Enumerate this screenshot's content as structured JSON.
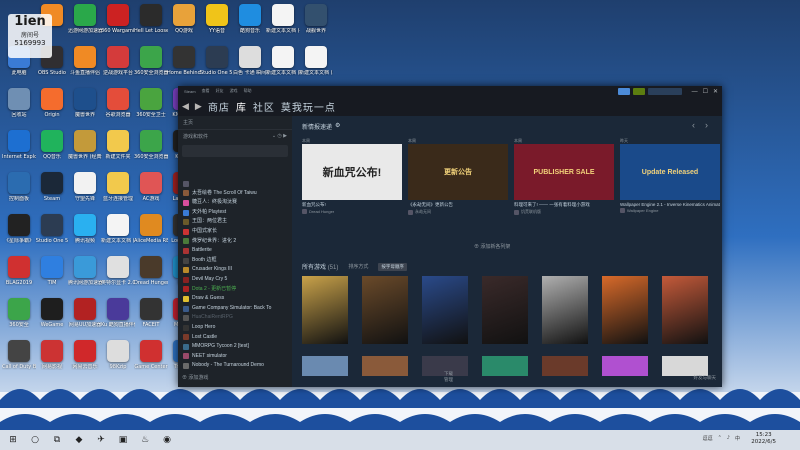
{
  "streamer": {
    "name": "1ien",
    "badge": "房间号",
    "room": "5169993"
  },
  "desktop": {
    "icons": [
      {
        "label": "Internet Explorer",
        "col": 0,
        "row": 3,
        "color": "#1d6fd1"
      },
      {
        "label": "",
        "col": 1,
        "row": 0,
        "color": "#f08a24"
      },
      {
        "label": "斗鱼直播伴侣",
        "col": 1,
        "row": 0,
        "color": "#f08a24"
      },
      {
        "label": "迅游网游加速器",
        "col": 2,
        "row": 0,
        "color": "#2aa84a"
      },
      {
        "label": "360 Wargami...",
        "col": 3,
        "row": 0,
        "color": "#cc2222"
      },
      {
        "label": "Hell Let Loose",
        "col": 4,
        "row": 0,
        "color": "#2b2b2b"
      },
      {
        "label": "QQ游戏",
        "col": 5,
        "row": 0,
        "color": "#e8a23a"
      },
      {
        "label": "YY语音",
        "col": 6,
        "row": 0,
        "color": "#f0c419"
      },
      {
        "label": "酷狗音乐",
        "col": 7,
        "row": 0,
        "color": "#1f8de0"
      },
      {
        "label": "新建文本文档 (4).txt",
        "col": 8,
        "row": 0,
        "color": "#f4f4f4"
      },
      {
        "label": "战舰世界",
        "col": 9,
        "row": 0,
        "color": "#33506e"
      },
      {
        "label": "此电脑",
        "col": 0,
        "row": 1,
        "color": "#3a7bd5"
      },
      {
        "label": "OBS Studio",
        "col": 1,
        "row": 1,
        "color": "#302e31"
      },
      {
        "label": "斗鱼直播伴侣",
        "col": 2,
        "row": 1,
        "color": "#f08a24"
      },
      {
        "label": "逆战游戏平台",
        "col": 3,
        "row": 1,
        "color": "#d43b3b"
      },
      {
        "label": "360安全浏览器",
        "col": 4,
        "row": 1,
        "color": "#3ca54a"
      },
      {
        "label": "Home Behind 2",
        "col": 5,
        "row": 1,
        "color": "#333"
      },
      {
        "label": "Studio One 5 Professi...",
        "col": 6,
        "row": 1,
        "color": "#2c3c52"
      },
      {
        "label": "白色 卡通 瞬间...",
        "col": 7,
        "row": 1,
        "color": "#ddd"
      },
      {
        "label": "新建文本文档 (2).txt",
        "col": 8,
        "row": 1,
        "color": "#f4f4f4"
      },
      {
        "label": "新建文本文档 (5).txt",
        "col": 9,
        "row": 1,
        "color": "#f4f4f4"
      },
      {
        "label": "回收站",
        "col": 0,
        "row": 2,
        "color": "#6f8fb3"
      },
      {
        "label": "Origin",
        "col": 1,
        "row": 2,
        "color": "#f56c2d"
      },
      {
        "label": "魔兽世界",
        "col": 2,
        "row": 2,
        "color": "#1e4f8c"
      },
      {
        "label": "谷歌浏览器",
        "col": 3,
        "row": 2,
        "color": "#e44d3a"
      },
      {
        "label": "360安全卫士",
        "col": 4,
        "row": 2,
        "color": "#4aa43f"
      },
      {
        "label": "KMPlayer",
        "col": 5,
        "row": 2,
        "color": "#7a3fbf"
      },
      {
        "label": "QQ音乐",
        "col": 1,
        "row": 3,
        "color": "#20b35c"
      },
      {
        "label": "魔兽世界 (经典怀旧服)",
        "col": 2,
        "row": 3,
        "color": "#c39a3a"
      },
      {
        "label": "新建文件夹",
        "col": 3,
        "row": 3,
        "color": "#f2c94c"
      },
      {
        "label": "360安全浏览器",
        "col": 4,
        "row": 3,
        "color": "#3ca54a"
      },
      {
        "label": "KKmini",
        "col": 5,
        "row": 3,
        "color": "#222"
      },
      {
        "label": "控制面板",
        "col": 0,
        "row": 4,
        "color": "#2b6cb0"
      },
      {
        "label": "Steam",
        "col": 1,
        "row": 4,
        "color": "#1b2838"
      },
      {
        "label": "守望先锋",
        "col": 2,
        "row": 4,
        "color": "#f2f2f2"
      },
      {
        "label": "蓝牙连接管理",
        "col": 3,
        "row": 4,
        "color": "#f2c94c"
      },
      {
        "label": "AC游戏",
        "col": 4,
        "row": 4,
        "color": "#e05555"
      },
      {
        "label": "Launch...",
        "col": 5,
        "row": 4,
        "color": "#a02020"
      },
      {
        "label": "《星际争霸》",
        "col": 0,
        "row": 5,
        "color": "#222"
      },
      {
        "label": "Studio One 5",
        "col": 1,
        "row": 5,
        "color": "#2c3c52"
      },
      {
        "label": "腾讯视频",
        "col": 2,
        "row": 5,
        "color": "#2ab0f0"
      },
      {
        "label": "新建文本文档 (2)",
        "col": 3,
        "row": 5,
        "color": "#f4f4f4"
      },
      {
        "label": "AliceMedia RECentral 4",
        "col": 4,
        "row": 5,
        "color": "#e08a20"
      },
      {
        "label": "Loop Hero",
        "col": 5,
        "row": 5,
        "color": "#333"
      },
      {
        "label": "BLAG2019",
        "col": 0,
        "row": 6,
        "color": "#d03030"
      },
      {
        "label": "TIM",
        "col": 1,
        "row": 6,
        "color": "#2f7fe0"
      },
      {
        "label": "腾讯网游加速器",
        "col": 2,
        "row": 6,
        "color": "#3a9ad9"
      },
      {
        "label": "英特尔显卡 2.0",
        "col": 3,
        "row": 6,
        "color": "#e0e0e0"
      },
      {
        "label": "Dread Hunger",
        "col": 4,
        "row": 6,
        "color": "#4a3a2a"
      },
      {
        "label": "Edge",
        "col": 5,
        "row": 6,
        "color": "#1e90c8"
      },
      {
        "label": "360安全",
        "col": 0,
        "row": 7,
        "color": "#3ca54a"
      },
      {
        "label": "WeGame",
        "col": 1,
        "row": 7,
        "color": "#1e1e1e"
      },
      {
        "label": "网易UU加速器",
        "col": 2,
        "row": 7,
        "color": "#b22222"
      },
      {
        "label": "Ku 酷狗直播伴侣",
        "col": 3,
        "row": 7,
        "color": "#4a3a9a"
      },
      {
        "label": "FACEIT",
        "col": 4,
        "row": 7,
        "color": "#333"
      },
      {
        "label": "MiniCr...",
        "col": 5,
        "row": 7,
        "color": "#c02030"
      },
      {
        "label": "Call of Duty Black Ops 4",
        "col": 0,
        "row": 8,
        "color": "#444"
      },
      {
        "label": "网易影视",
        "col": 1,
        "row": 8,
        "color": "#c33"
      },
      {
        "label": "网易云音乐",
        "col": 2,
        "row": 8,
        "color": "#d0282a"
      },
      {
        "label": "98Kzip",
        "col": 3,
        "row": 8,
        "color": "#ddd"
      },
      {
        "label": "Game Center",
        "col": 4,
        "row": 8,
        "color": "#d03030"
      },
      {
        "label": "Traffic...",
        "col": 5,
        "row": 8,
        "color": "#2c6fbf"
      }
    ]
  },
  "steam": {
    "menu": [
      "Steam",
      "查看",
      "好友",
      "游戏",
      "帮助"
    ],
    "nav": {
      "back": "◀",
      "forward": "▶",
      "items": [
        "商店",
        "库",
        "社区",
        "莫我玩一点"
      ]
    },
    "side": {
      "home": "主页",
      "filter": "游戏和软件",
      "games": [
        {
          "name": "",
          "color": "#556",
          "state": ""
        },
        {
          "name": "太吾绘卷 The Scroll Of Taiwu",
          "color": "#8a5a3a",
          "state": ""
        },
        {
          "name": "糖豆人：终极淘汰赛",
          "color": "#d94e9e",
          "state": ""
        },
        {
          "name": "天外帕 Playtest",
          "color": "#3a7bd5",
          "state": ""
        },
        {
          "name": "王国：两位君主",
          "color": "#6a5a2a",
          "state": ""
        },
        {
          "name": "中国式家长",
          "color": "#c33",
          "state": ""
        },
        {
          "name": "侏罗纪世界：进化 2",
          "color": "#4a7a3a",
          "state": ""
        },
        {
          "name": "Battlerite",
          "color": "#a33",
          "state": ""
        },
        {
          "name": "Booth 边框",
          "color": "#444",
          "state": ""
        },
        {
          "name": "Crusader Kings III",
          "color": "#b98a2a",
          "state": ""
        },
        {
          "name": "Devil May Cry 5",
          "color": "#822",
          "state": ""
        },
        {
          "name": "Dota 2 - 更新已暂停",
          "color": "#a22",
          "state": "upd"
        },
        {
          "name": "Draw & Guess",
          "color": "#e0c030",
          "state": ""
        },
        {
          "name": "Game Company Simulator: Back To",
          "color": "#3a5a8a",
          "state": ""
        },
        {
          "name": "HuaChaiRentRPG",
          "color": "#555",
          "state": "dim"
        },
        {
          "name": "Loop Hero",
          "color": "#333",
          "state": ""
        },
        {
          "name": "Lost Castle",
          "color": "#7a3a2a",
          "state": ""
        },
        {
          "name": "MMORPG Tycoon 2 [test]",
          "color": "#3a6a8a",
          "state": ""
        },
        {
          "name": "NEET simulator",
          "color": "#9a4a6a",
          "state": ""
        },
        {
          "name": "Nobody - The Turnaround Demo",
          "color": "#6a6a6a",
          "state": ""
        }
      ],
      "add_game": "添加游戏"
    },
    "shelf": {
      "title": "新情报速递",
      "gear": "⚙",
      "news": [
        {
          "when": "本周",
          "caption": "新血咒公布!",
          "source": "Dread Hunger",
          "text": "新血咒公布!",
          "bg": "#e9e9e9"
        },
        {
          "when": "本周",
          "caption": "《永劫无间》更新公告",
          "source": "永劫无间",
          "text": "更新公告",
          "bg": "#3a2a1a"
        },
        {
          "when": "本周",
          "caption": "料理可来了! —— 一张有着料理小游戏",
          "source": "饥荒联机版",
          "text": "PUBLISHER SALE",
          "bg": "#7a1a2a"
        },
        {
          "when": "昨天",
          "caption": "Wallpaper Engine 2.1 - Inverse Kinematics Animations, User Texture...",
          "source": "Wallpaper Engine",
          "text": "Update Released",
          "bg": "#1a4a8a"
        }
      ],
      "add_shelf": "⊕  添加新各列架",
      "all_games": "所有游戏",
      "count": "(51)",
      "sort_label": "排序方式",
      "sort_value": "按字母顺序"
    },
    "covers_row1": [
      "#c9a24a",
      "#6a4a2a",
      "#2a4a8a",
      "#3a2a2a",
      "#b0b0b0",
      "#d86a2a",
      "#c45a3a"
    ],
    "covers_row2": [
      "#6a8ab0",
      "#8a5a3a",
      "#3a3a4a",
      "#2a8a6a",
      "#6a3a2a",
      "#b050d0",
      "#d8d8d8"
    ],
    "footer": {
      "downloads": "下载",
      "downloads_sub": "管理",
      "friends": "好友与聊天"
    }
  },
  "taskbar": {
    "items": [
      "⊞",
      "○",
      "⧉",
      "◆",
      "✈",
      "▣",
      "♨",
      "◉"
    ],
    "tray": [
      "逗逗",
      "⌃",
      "♪",
      "中"
    ],
    "time": "15:23",
    "date": "2022/6/5"
  }
}
